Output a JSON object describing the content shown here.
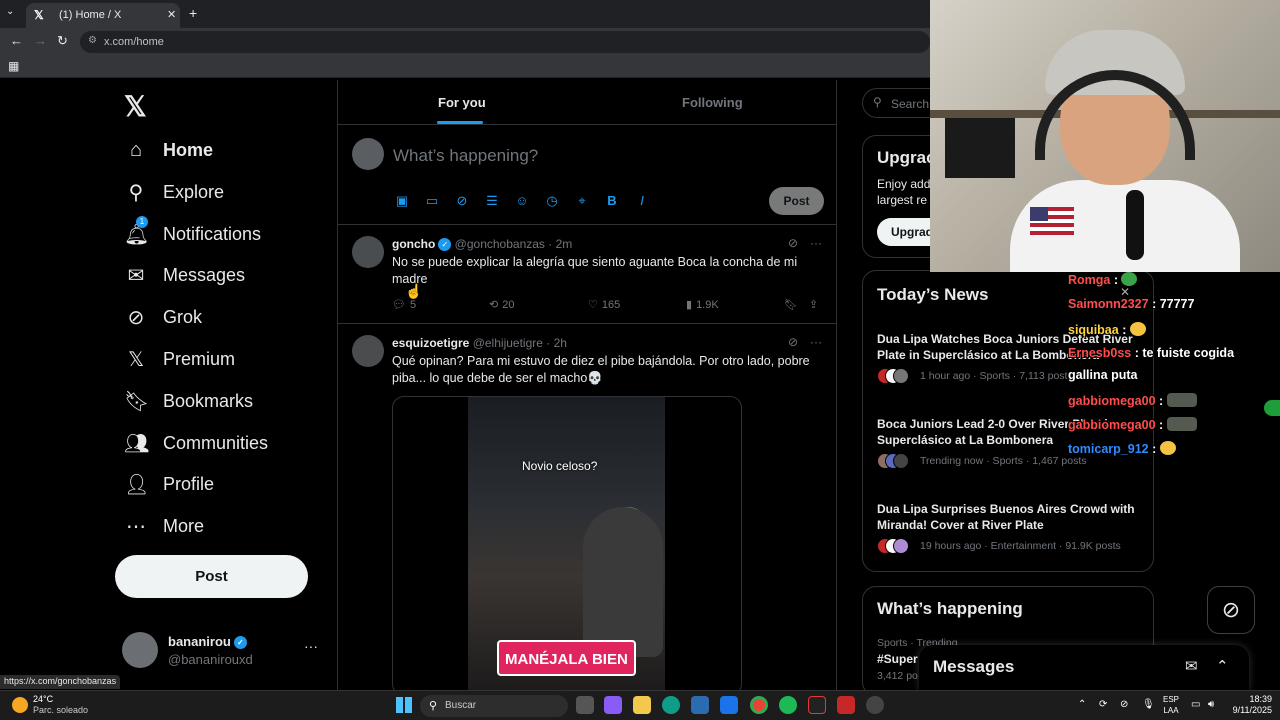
{
  "browser": {
    "tab_title": "(1) Home / X",
    "url": "x.com/home",
    "status_url": "https://x.com/gonchobanzas"
  },
  "sidebar": {
    "items": [
      {
        "label": "Home",
        "icon": "home-icon"
      },
      {
        "label": "Explore",
        "icon": "search-icon"
      },
      {
        "label": "Notifications",
        "icon": "bell-icon",
        "badge": "1"
      },
      {
        "label": "Messages",
        "icon": "mail-icon"
      },
      {
        "label": "Grok",
        "icon": "grok-icon"
      },
      {
        "label": "Premium",
        "icon": "x-icon"
      },
      {
        "label": "Bookmarks",
        "icon": "bookmark-icon"
      },
      {
        "label": "Communities",
        "icon": "people-icon"
      },
      {
        "label": "Profile",
        "icon": "person-icon"
      },
      {
        "label": "More",
        "icon": "more-circle-icon"
      }
    ],
    "post_label": "Post",
    "account": {
      "name": "bananirou",
      "handle": "@bananirouxd"
    }
  },
  "feed": {
    "tabs": [
      "For you",
      "Following"
    ],
    "active_tab": "For you",
    "composer": {
      "placeholder": "What’s happening?",
      "post_label": "Post"
    },
    "tweets": [
      {
        "name": "goncho",
        "handle": "@gonchobanzas",
        "time": "· 2m",
        "text": "No se puede explicar la alegría que siento aguante Boca la concha de mi madre",
        "replies": "5",
        "reposts": "20",
        "likes": "165",
        "views": "1.9K"
      },
      {
        "name": "esquizoetigre",
        "handle": "@elhijuetigre",
        "time": "· 2h",
        "text": "Qué opinan? Para mi estuvo de diez el pibe bajándola. Por otro lado, pobre piba... lo que debe de ser el macho💀",
        "video_caption": "Novio celoso?",
        "video_banner": "MANÉJALA BIEN"
      }
    ]
  },
  "right": {
    "search_placeholder": "Search",
    "premium": {
      "title": "Upgrac",
      "text": "Enjoy add\nlargest re",
      "button": "Upgrad"
    },
    "news": {
      "title": "Today’s News",
      "items": [
        {
          "headline": "Dua Lipa Watches Boca Juniors Defeat River Plate in Superclásico at La Bombonera",
          "meta": "1 hour ago · Sports · 7,113 posts"
        },
        {
          "headline": "Boca Juniors Lead 2-0 Over River Plate in Superclásico at La Bombonera",
          "meta": "Trending now · Sports · 1,467 posts"
        },
        {
          "headline": "Dua Lipa Surprises Buenos Aires Crowd with Miranda! Cover at River Plate",
          "meta": "19 hours ago · Entertainment · 91.9K posts"
        }
      ]
    },
    "whats_happening": {
      "title": "What’s happening",
      "category": "Sports · Trending",
      "tag": "#Super",
      "count": "3,412 po"
    },
    "messages_title": "Messages"
  },
  "chat": [
    {
      "user": "Romga",
      "color": "#ff4d4d",
      "msg": ""
    },
    {
      "user": "Saimonn2327",
      "color": "#ff4d4d",
      "msg": "77777"
    },
    {
      "user": "siquibaa",
      "color": "#ffd23f",
      "msg": ""
    },
    {
      "user": "Ernesb0ss",
      "color": "#ff4d4d",
      "msg": "te fuiste cogida"
    },
    {
      "user": "",
      "color": "#ffffff",
      "msg": "gallina puta"
    },
    {
      "user": "gabbiomega00",
      "color": "#ff4d4d",
      "msg": ""
    },
    {
      "user": "gabbiomega00",
      "color": "#ff4d4d",
      "msg": ""
    },
    {
      "user": "tomicarp_912",
      "color": "#2e8bff",
      "msg": ""
    }
  ],
  "taskbar": {
    "weather_temp": "24°C",
    "weather_desc": "Parc. soleado",
    "search": "Buscar",
    "lang_line1": "ESP",
    "lang_line2": "LAA",
    "time": "18:39",
    "date": "9/11/2025"
  }
}
